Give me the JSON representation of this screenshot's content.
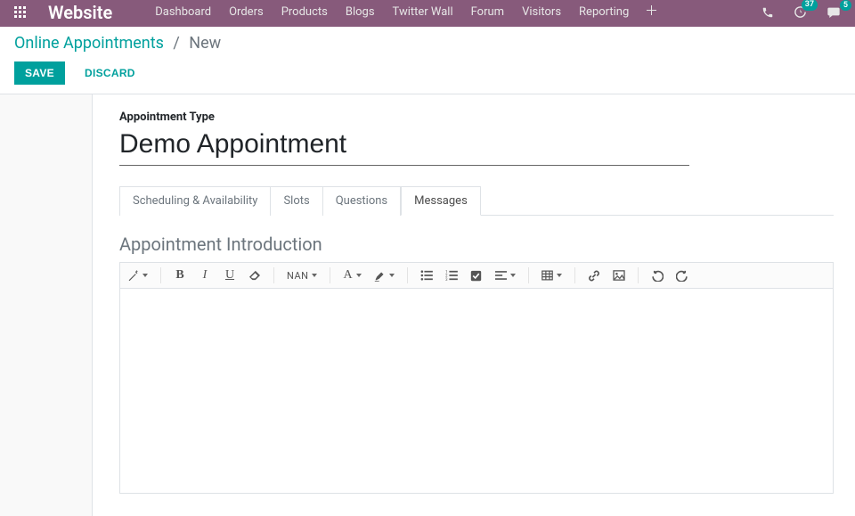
{
  "navbar": {
    "brand": "Website",
    "menu": [
      "Dashboard",
      "Orders",
      "Products",
      "Blogs",
      "Twitter Wall",
      "Forum",
      "Visitors",
      "Reporting"
    ],
    "badges": {
      "timer": "37",
      "messages": "5"
    }
  },
  "breadcrumb": {
    "parent": "Online Appointments",
    "current": "New"
  },
  "buttons": {
    "save": "SAVE",
    "discard": "DISCARD"
  },
  "form": {
    "type_label": "Appointment Type",
    "title_value": "Demo Appointment",
    "tabs": [
      "Scheduling & Availability",
      "Slots",
      "Questions",
      "Messages"
    ],
    "active_tab_index": 3,
    "section_heading": "Appointment Introduction",
    "toolbar": {
      "size_label": "NAN"
    }
  }
}
